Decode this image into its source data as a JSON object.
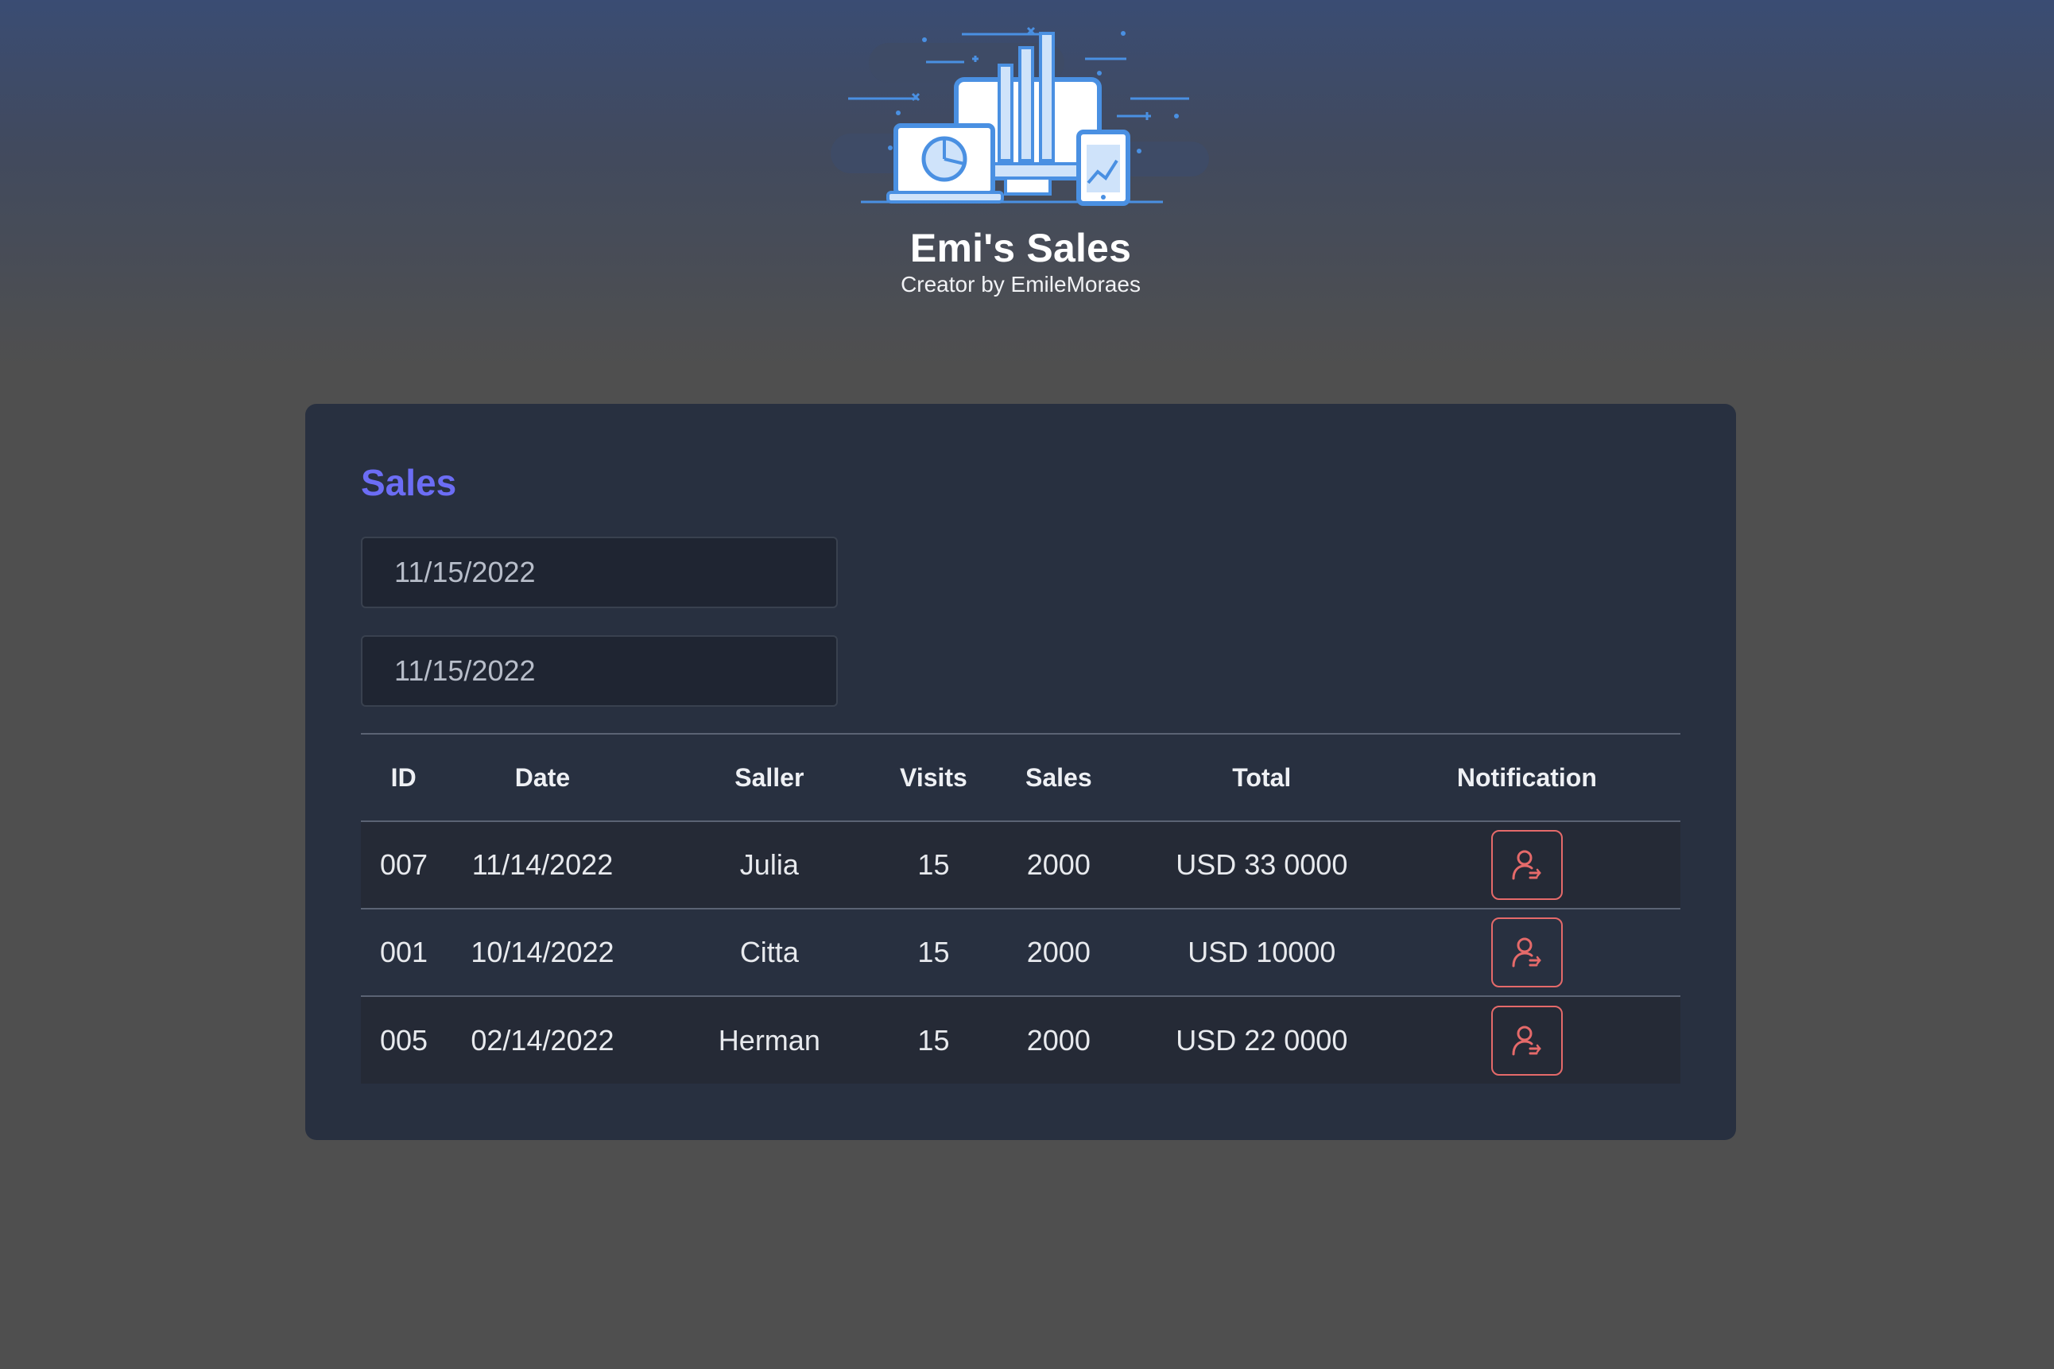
{
  "header": {
    "title": "Emi's Sales",
    "subtitle": "Creator by EmileMoraes",
    "logo_icon": "sales-devices-illustration-icon"
  },
  "sales_card": {
    "title": "Sales",
    "date_start": "11/15/2022",
    "date_end": "11/15/2022",
    "table": {
      "headers": [
        "ID",
        "Date",
        "Saller",
        "Visits",
        "Sales",
        "Total",
        "Notification"
      ],
      "rows": [
        {
          "id": "007",
          "date": "11/14/2022",
          "saller": "Julia",
          "visits": "15",
          "sales": "2000",
          "total": "USD 33 0000"
        },
        {
          "id": "001",
          "date": "10/14/2022",
          "saller": "Citta",
          "visits": "15",
          "sales": "2000",
          "total": "USD 10000"
        },
        {
          "id": "005",
          "date": "02/14/2022",
          "saller": "Herman",
          "visits": "15",
          "sales": "2000",
          "total": "USD 22 0000"
        }
      ],
      "notification_icon": "user-notify-icon"
    }
  },
  "colors": {
    "accent": "#6c6df5",
    "notification": "#e56a6a",
    "card_background": "#283040",
    "page_background": "#4f4f4f"
  }
}
